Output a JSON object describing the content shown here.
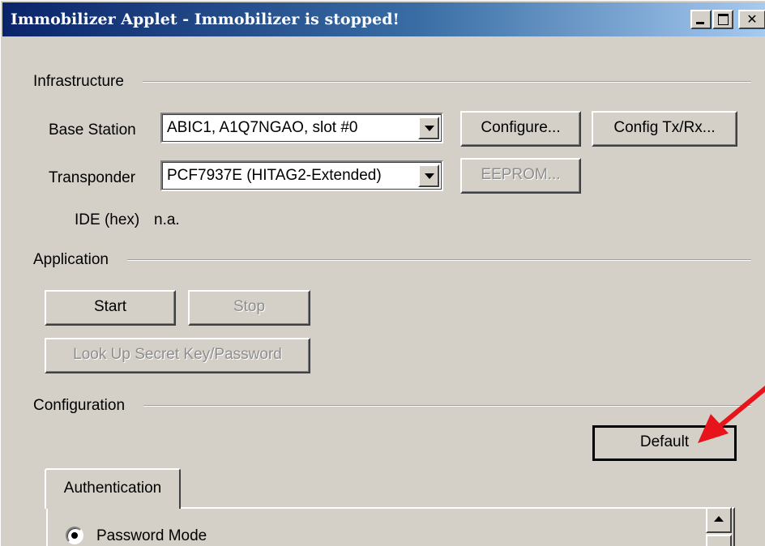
{
  "window": {
    "title": "Immobilizer Applet - Immobilizer is stopped!"
  },
  "infrastructure": {
    "heading": "Infrastructure",
    "base_station_label": "Base Station",
    "base_station_value": "ABIC1, A1Q7NGAO, slot #0",
    "configure_label": "Configure...",
    "config_txrx_label": "Config Tx/Rx...",
    "transponder_label": "Transponder",
    "transponder_value": "PCF7937E (HITAG2-Extended)",
    "eeprom_label": "EEPROM...",
    "ide_label": "IDE (hex)",
    "ide_value": "n.a."
  },
  "application": {
    "heading": "Application",
    "start_label": "Start",
    "stop_label": "Stop",
    "lookup_label": "Look Up Secret Key/Password"
  },
  "configuration": {
    "heading": "Configuration",
    "default_label": "Default",
    "tabs": [
      {
        "label": "Authentication",
        "selected": true
      }
    ],
    "password_mode_label": "Password Mode",
    "password_mode_selected": true
  },
  "colors": {
    "face": "#d4d0c8",
    "title_start": "#0a246a",
    "title_end": "#a6caf0",
    "annotation_arrow": "#e8141c"
  }
}
